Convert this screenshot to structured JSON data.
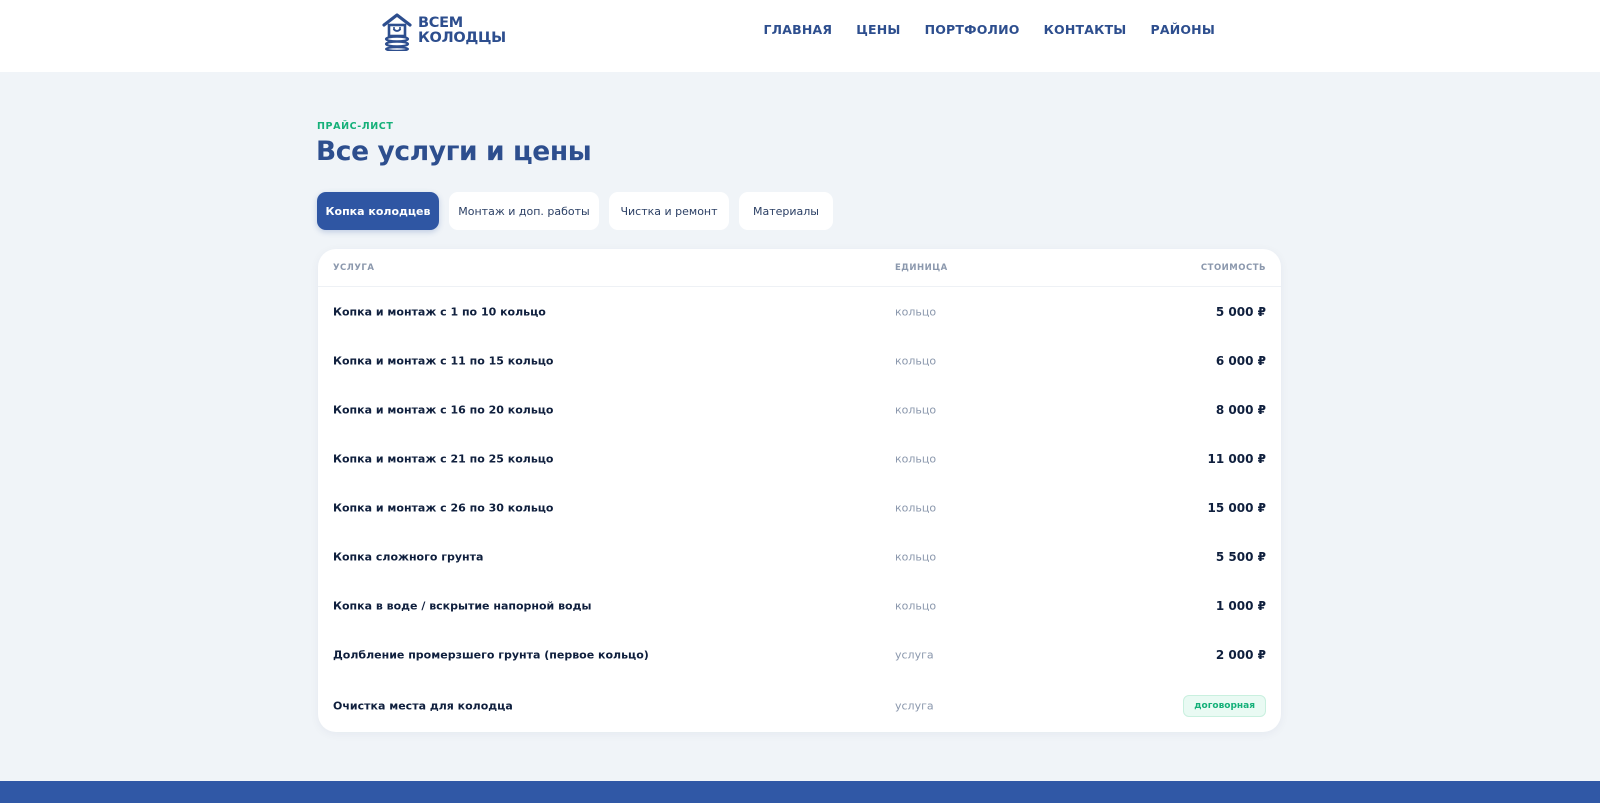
{
  "header": {
    "logo": {
      "line1": "ВСЕМ",
      "line2": "КОЛОДЦЫ"
    },
    "nav": [
      "ГЛАВНАЯ",
      "ЦЕНЫ",
      "ПОРТФОЛИО",
      "КОНТАКТЫ",
      "РАЙОНЫ"
    ]
  },
  "section": {
    "eyebrow": "ПРАЙС-ЛИСТ",
    "title": "Все услуги и цены"
  },
  "tabs": [
    {
      "label": "Копка колодцев",
      "active": true
    },
    {
      "label": "Монтаж и доп. работы",
      "active": false
    },
    {
      "label": "Чистка и ремонт",
      "active": false
    },
    {
      "label": "Материалы",
      "active": false
    }
  ],
  "table": {
    "columns": {
      "service": "УСЛУГА",
      "unit": "ЕДИНИЦА",
      "price": "СТОИМОСТЬ"
    },
    "rows": [
      {
        "service": "Копка и монтаж с 1 по 10 кольцо",
        "unit": "кольцо",
        "price": "5 000 ₽"
      },
      {
        "service": "Копка и монтаж с 11 по 15 кольцо",
        "unit": "кольцо",
        "price": "6 000 ₽"
      },
      {
        "service": "Копка и монтаж с 16 по 20 кольцо",
        "unit": "кольцо",
        "price": "8 000 ₽"
      },
      {
        "service": "Копка и монтаж с 21 по 25 кольцо",
        "unit": "кольцо",
        "price": "11 000 ₽"
      },
      {
        "service": "Копка и монтаж с 26 по 30 кольцо",
        "unit": "кольцо",
        "price": "15 000 ₽"
      },
      {
        "service": "Копка сложного грунта",
        "unit": "кольцо",
        "price": "5 500 ₽"
      },
      {
        "service": "Копка в воде / вскрытие напорной воды",
        "unit": "кольцо",
        "price": "1 000 ₽"
      },
      {
        "service": "Долбление промерзшего грунта (первое кольцо)",
        "unit": "услуга",
        "price": "2 000 ₽"
      },
      {
        "service": "Очистка места для колодца",
        "unit": "услуга",
        "badge": "договорная"
      }
    ]
  },
  "colors": {
    "brand": "#2f56a3",
    "accent_green": "#15b079",
    "background": "#f0f4f8"
  },
  "icons": {
    "logo": "well-house-icon"
  }
}
